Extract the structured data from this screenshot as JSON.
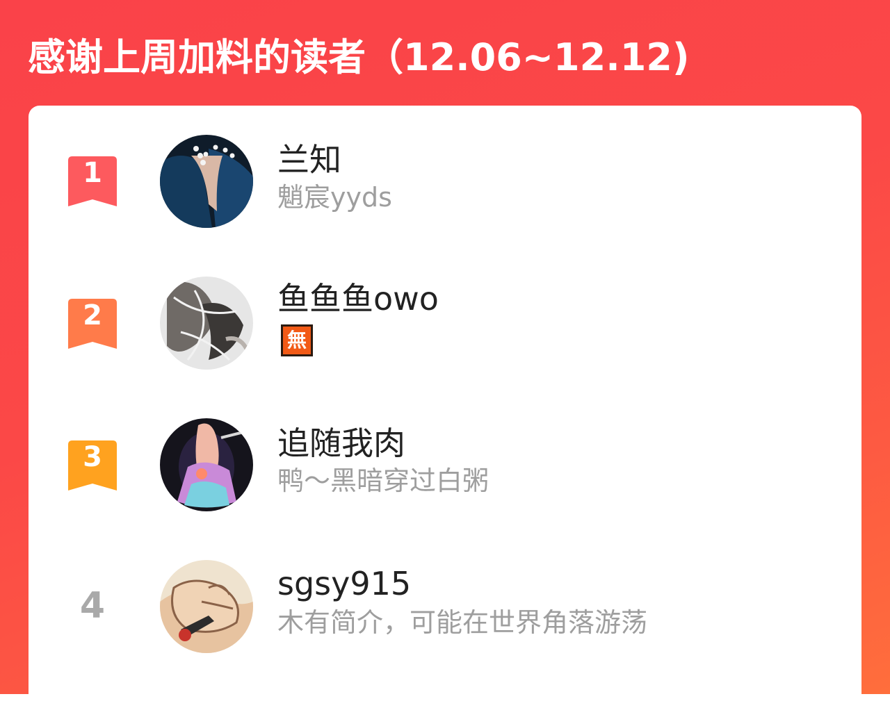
{
  "header": {
    "title": "感谢上周加料的读者（12.06~12.12)"
  },
  "colors": {
    "background_top": "#fa4249",
    "background_bottom": "#ff6e3c",
    "rank1": "#fd5a5e",
    "rank2": "#ff7b4a",
    "rank3": "#ffa21f",
    "rank_plain": "#a9a9a9",
    "name": "#222222",
    "subtitle": "#9e9e9e"
  },
  "readers": [
    {
      "rank": "1",
      "name": "兰知",
      "subtitle": "魈宸yyds",
      "avatar_icon": "avatar-dark-blue-dress-icon"
    },
    {
      "rank": "2",
      "name": "鱼鱼鱼owo",
      "badge": "無",
      "avatar_icon": "avatar-sketch-figure-icon"
    },
    {
      "rank": "3",
      "name": "追随我肉",
      "subtitle": "鸭～黑暗穿过白粥",
      "avatar_icon": "avatar-singer-stage-icon"
    },
    {
      "rank": "4",
      "name": "sgsy915",
      "subtitle": "木有简介，可能在世界角落游荡",
      "avatar_icon": "avatar-hand-drawing-icon"
    }
  ]
}
